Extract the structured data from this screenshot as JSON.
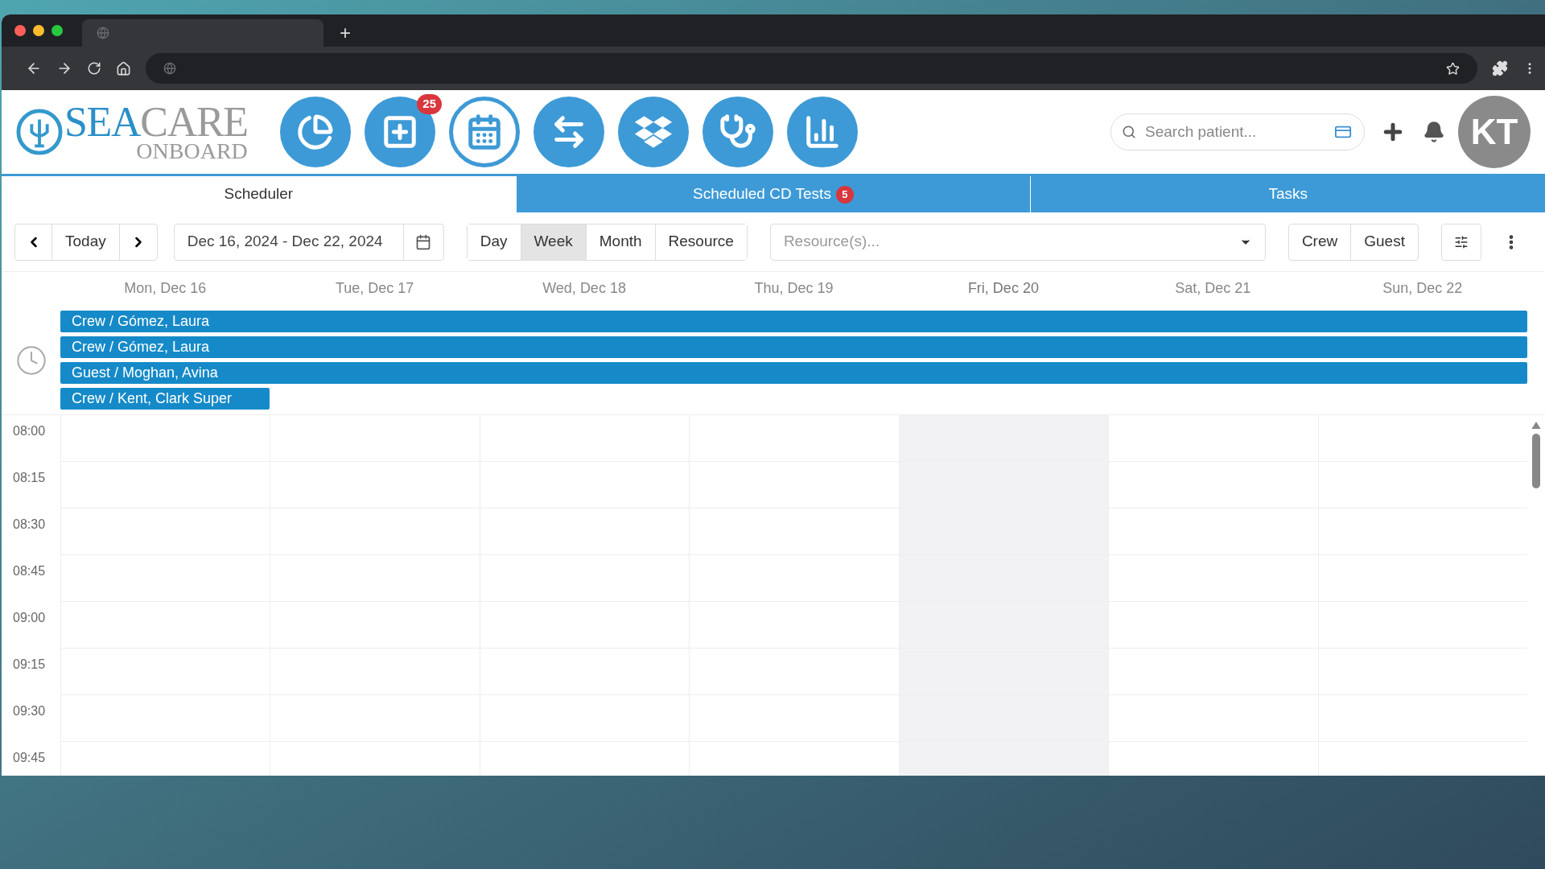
{
  "browser": {
    "new_tab": "+"
  },
  "logo": {
    "main_blue": "SEA",
    "main_gray": "CARE",
    "sub": "ONBOARD"
  },
  "nav": [
    {
      "selected": false
    },
    {
      "selected": false,
      "badge": "25"
    },
    {
      "selected": true
    },
    {
      "selected": false
    },
    {
      "selected": false
    },
    {
      "selected": false
    },
    {
      "selected": false
    }
  ],
  "search": {
    "placeholder": "Search patient..."
  },
  "avatar": "KT",
  "tabs": [
    {
      "label": "Scheduler",
      "selected": true
    },
    {
      "label": "Scheduled CD Tests",
      "selected": false,
      "badge": "5"
    },
    {
      "label": "Tasks",
      "selected": false
    }
  ],
  "toolbar": {
    "today": "Today",
    "date_range": "Dec 16, 2024 - Dec 22, 2024",
    "views": [
      {
        "label": "Day",
        "selected": false
      },
      {
        "label": "Week",
        "selected": true
      },
      {
        "label": "Month",
        "selected": false
      },
      {
        "label": "Resource",
        "selected": false
      }
    ],
    "resources_placeholder": "Resource(s)...",
    "filters": [
      {
        "label": "Crew"
      },
      {
        "label": "Guest"
      }
    ]
  },
  "days": [
    {
      "label": "Mon, Dec 16",
      "highlighted": false
    },
    {
      "label": "Tue, Dec 17",
      "highlighted": false
    },
    {
      "label": "Wed, Dec 18",
      "highlighted": false
    },
    {
      "label": "Thu, Dec 19",
      "highlighted": false
    },
    {
      "label": "Fri, Dec 20",
      "highlighted": true
    },
    {
      "label": "Sat, Dec 21",
      "highlighted": false
    },
    {
      "label": "Sun, Dec 22",
      "highlighted": false
    }
  ],
  "all_day_events": [
    {
      "label": "Crew / Gómez, Laura",
      "kind": "week"
    },
    {
      "label": "Crew / Gómez, Laura",
      "kind": "week"
    },
    {
      "label": "Guest / Moghan, Avina",
      "kind": "week"
    },
    {
      "label": "Crew / Kent, Clark Super",
      "kind": "day"
    }
  ],
  "times": [
    "08:00",
    "08:15",
    "08:30",
    "08:45",
    "09:00",
    "09:15",
    "09:30",
    "09:45"
  ]
}
